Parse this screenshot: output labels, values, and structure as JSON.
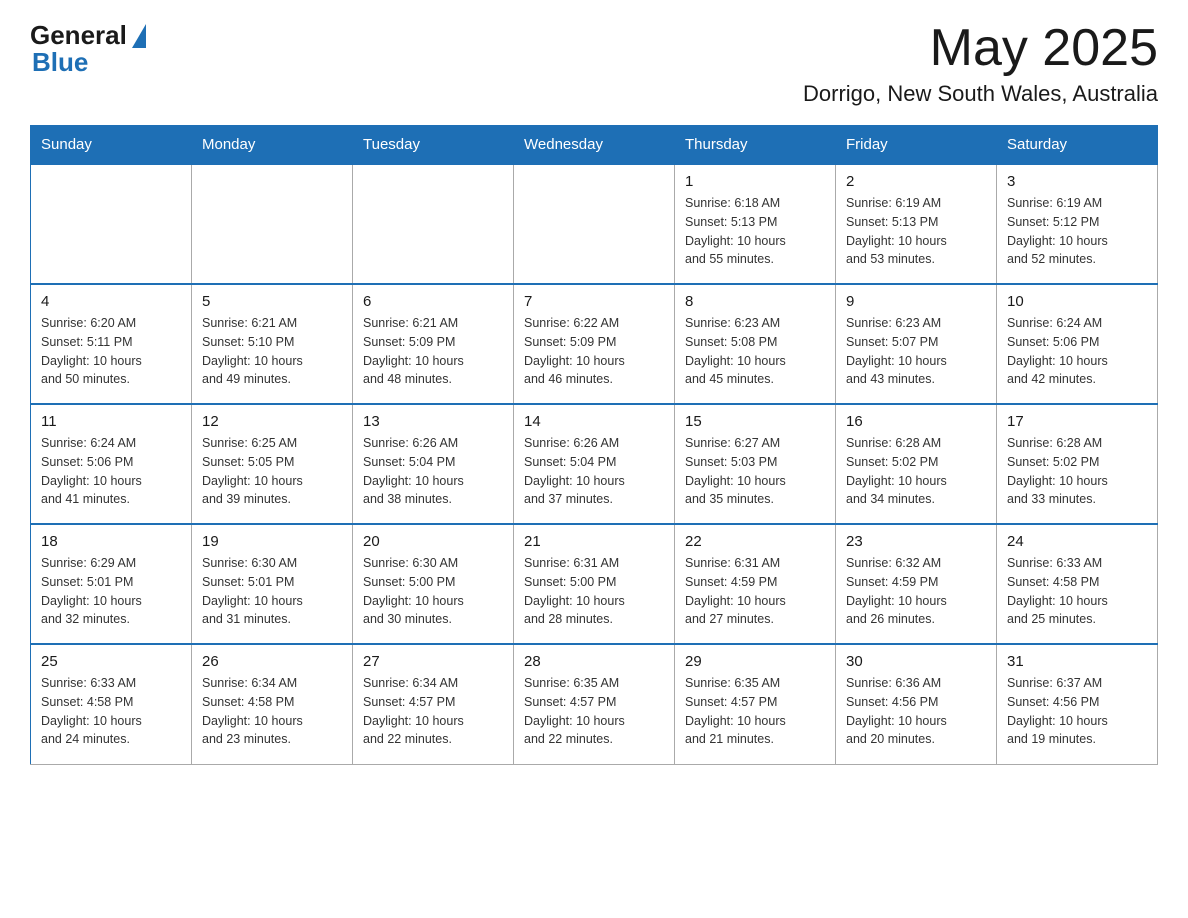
{
  "header": {
    "logo_general": "General",
    "logo_blue": "Blue",
    "month_title": "May 2025",
    "location": "Dorrigo, New South Wales, Australia"
  },
  "days_of_week": [
    "Sunday",
    "Monday",
    "Tuesday",
    "Wednesday",
    "Thursday",
    "Friday",
    "Saturday"
  ],
  "weeks": [
    [
      {
        "day": "",
        "info": ""
      },
      {
        "day": "",
        "info": ""
      },
      {
        "day": "",
        "info": ""
      },
      {
        "day": "",
        "info": ""
      },
      {
        "day": "1",
        "info": "Sunrise: 6:18 AM\nSunset: 5:13 PM\nDaylight: 10 hours\nand 55 minutes."
      },
      {
        "day": "2",
        "info": "Sunrise: 6:19 AM\nSunset: 5:13 PM\nDaylight: 10 hours\nand 53 minutes."
      },
      {
        "day": "3",
        "info": "Sunrise: 6:19 AM\nSunset: 5:12 PM\nDaylight: 10 hours\nand 52 minutes."
      }
    ],
    [
      {
        "day": "4",
        "info": "Sunrise: 6:20 AM\nSunset: 5:11 PM\nDaylight: 10 hours\nand 50 minutes."
      },
      {
        "day": "5",
        "info": "Sunrise: 6:21 AM\nSunset: 5:10 PM\nDaylight: 10 hours\nand 49 minutes."
      },
      {
        "day": "6",
        "info": "Sunrise: 6:21 AM\nSunset: 5:09 PM\nDaylight: 10 hours\nand 48 minutes."
      },
      {
        "day": "7",
        "info": "Sunrise: 6:22 AM\nSunset: 5:09 PM\nDaylight: 10 hours\nand 46 minutes."
      },
      {
        "day": "8",
        "info": "Sunrise: 6:23 AM\nSunset: 5:08 PM\nDaylight: 10 hours\nand 45 minutes."
      },
      {
        "day": "9",
        "info": "Sunrise: 6:23 AM\nSunset: 5:07 PM\nDaylight: 10 hours\nand 43 minutes."
      },
      {
        "day": "10",
        "info": "Sunrise: 6:24 AM\nSunset: 5:06 PM\nDaylight: 10 hours\nand 42 minutes."
      }
    ],
    [
      {
        "day": "11",
        "info": "Sunrise: 6:24 AM\nSunset: 5:06 PM\nDaylight: 10 hours\nand 41 minutes."
      },
      {
        "day": "12",
        "info": "Sunrise: 6:25 AM\nSunset: 5:05 PM\nDaylight: 10 hours\nand 39 minutes."
      },
      {
        "day": "13",
        "info": "Sunrise: 6:26 AM\nSunset: 5:04 PM\nDaylight: 10 hours\nand 38 minutes."
      },
      {
        "day": "14",
        "info": "Sunrise: 6:26 AM\nSunset: 5:04 PM\nDaylight: 10 hours\nand 37 minutes."
      },
      {
        "day": "15",
        "info": "Sunrise: 6:27 AM\nSunset: 5:03 PM\nDaylight: 10 hours\nand 35 minutes."
      },
      {
        "day": "16",
        "info": "Sunrise: 6:28 AM\nSunset: 5:02 PM\nDaylight: 10 hours\nand 34 minutes."
      },
      {
        "day": "17",
        "info": "Sunrise: 6:28 AM\nSunset: 5:02 PM\nDaylight: 10 hours\nand 33 minutes."
      }
    ],
    [
      {
        "day": "18",
        "info": "Sunrise: 6:29 AM\nSunset: 5:01 PM\nDaylight: 10 hours\nand 32 minutes."
      },
      {
        "day": "19",
        "info": "Sunrise: 6:30 AM\nSunset: 5:01 PM\nDaylight: 10 hours\nand 31 minutes."
      },
      {
        "day": "20",
        "info": "Sunrise: 6:30 AM\nSunset: 5:00 PM\nDaylight: 10 hours\nand 30 minutes."
      },
      {
        "day": "21",
        "info": "Sunrise: 6:31 AM\nSunset: 5:00 PM\nDaylight: 10 hours\nand 28 minutes."
      },
      {
        "day": "22",
        "info": "Sunrise: 6:31 AM\nSunset: 4:59 PM\nDaylight: 10 hours\nand 27 minutes."
      },
      {
        "day": "23",
        "info": "Sunrise: 6:32 AM\nSunset: 4:59 PM\nDaylight: 10 hours\nand 26 minutes."
      },
      {
        "day": "24",
        "info": "Sunrise: 6:33 AM\nSunset: 4:58 PM\nDaylight: 10 hours\nand 25 minutes."
      }
    ],
    [
      {
        "day": "25",
        "info": "Sunrise: 6:33 AM\nSunset: 4:58 PM\nDaylight: 10 hours\nand 24 minutes."
      },
      {
        "day": "26",
        "info": "Sunrise: 6:34 AM\nSunset: 4:58 PM\nDaylight: 10 hours\nand 23 minutes."
      },
      {
        "day": "27",
        "info": "Sunrise: 6:34 AM\nSunset: 4:57 PM\nDaylight: 10 hours\nand 22 minutes."
      },
      {
        "day": "28",
        "info": "Sunrise: 6:35 AM\nSunset: 4:57 PM\nDaylight: 10 hours\nand 22 minutes."
      },
      {
        "day": "29",
        "info": "Sunrise: 6:35 AM\nSunset: 4:57 PM\nDaylight: 10 hours\nand 21 minutes."
      },
      {
        "day": "30",
        "info": "Sunrise: 6:36 AM\nSunset: 4:56 PM\nDaylight: 10 hours\nand 20 minutes."
      },
      {
        "day": "31",
        "info": "Sunrise: 6:37 AM\nSunset: 4:56 PM\nDaylight: 10 hours\nand 19 minutes."
      }
    ]
  ]
}
